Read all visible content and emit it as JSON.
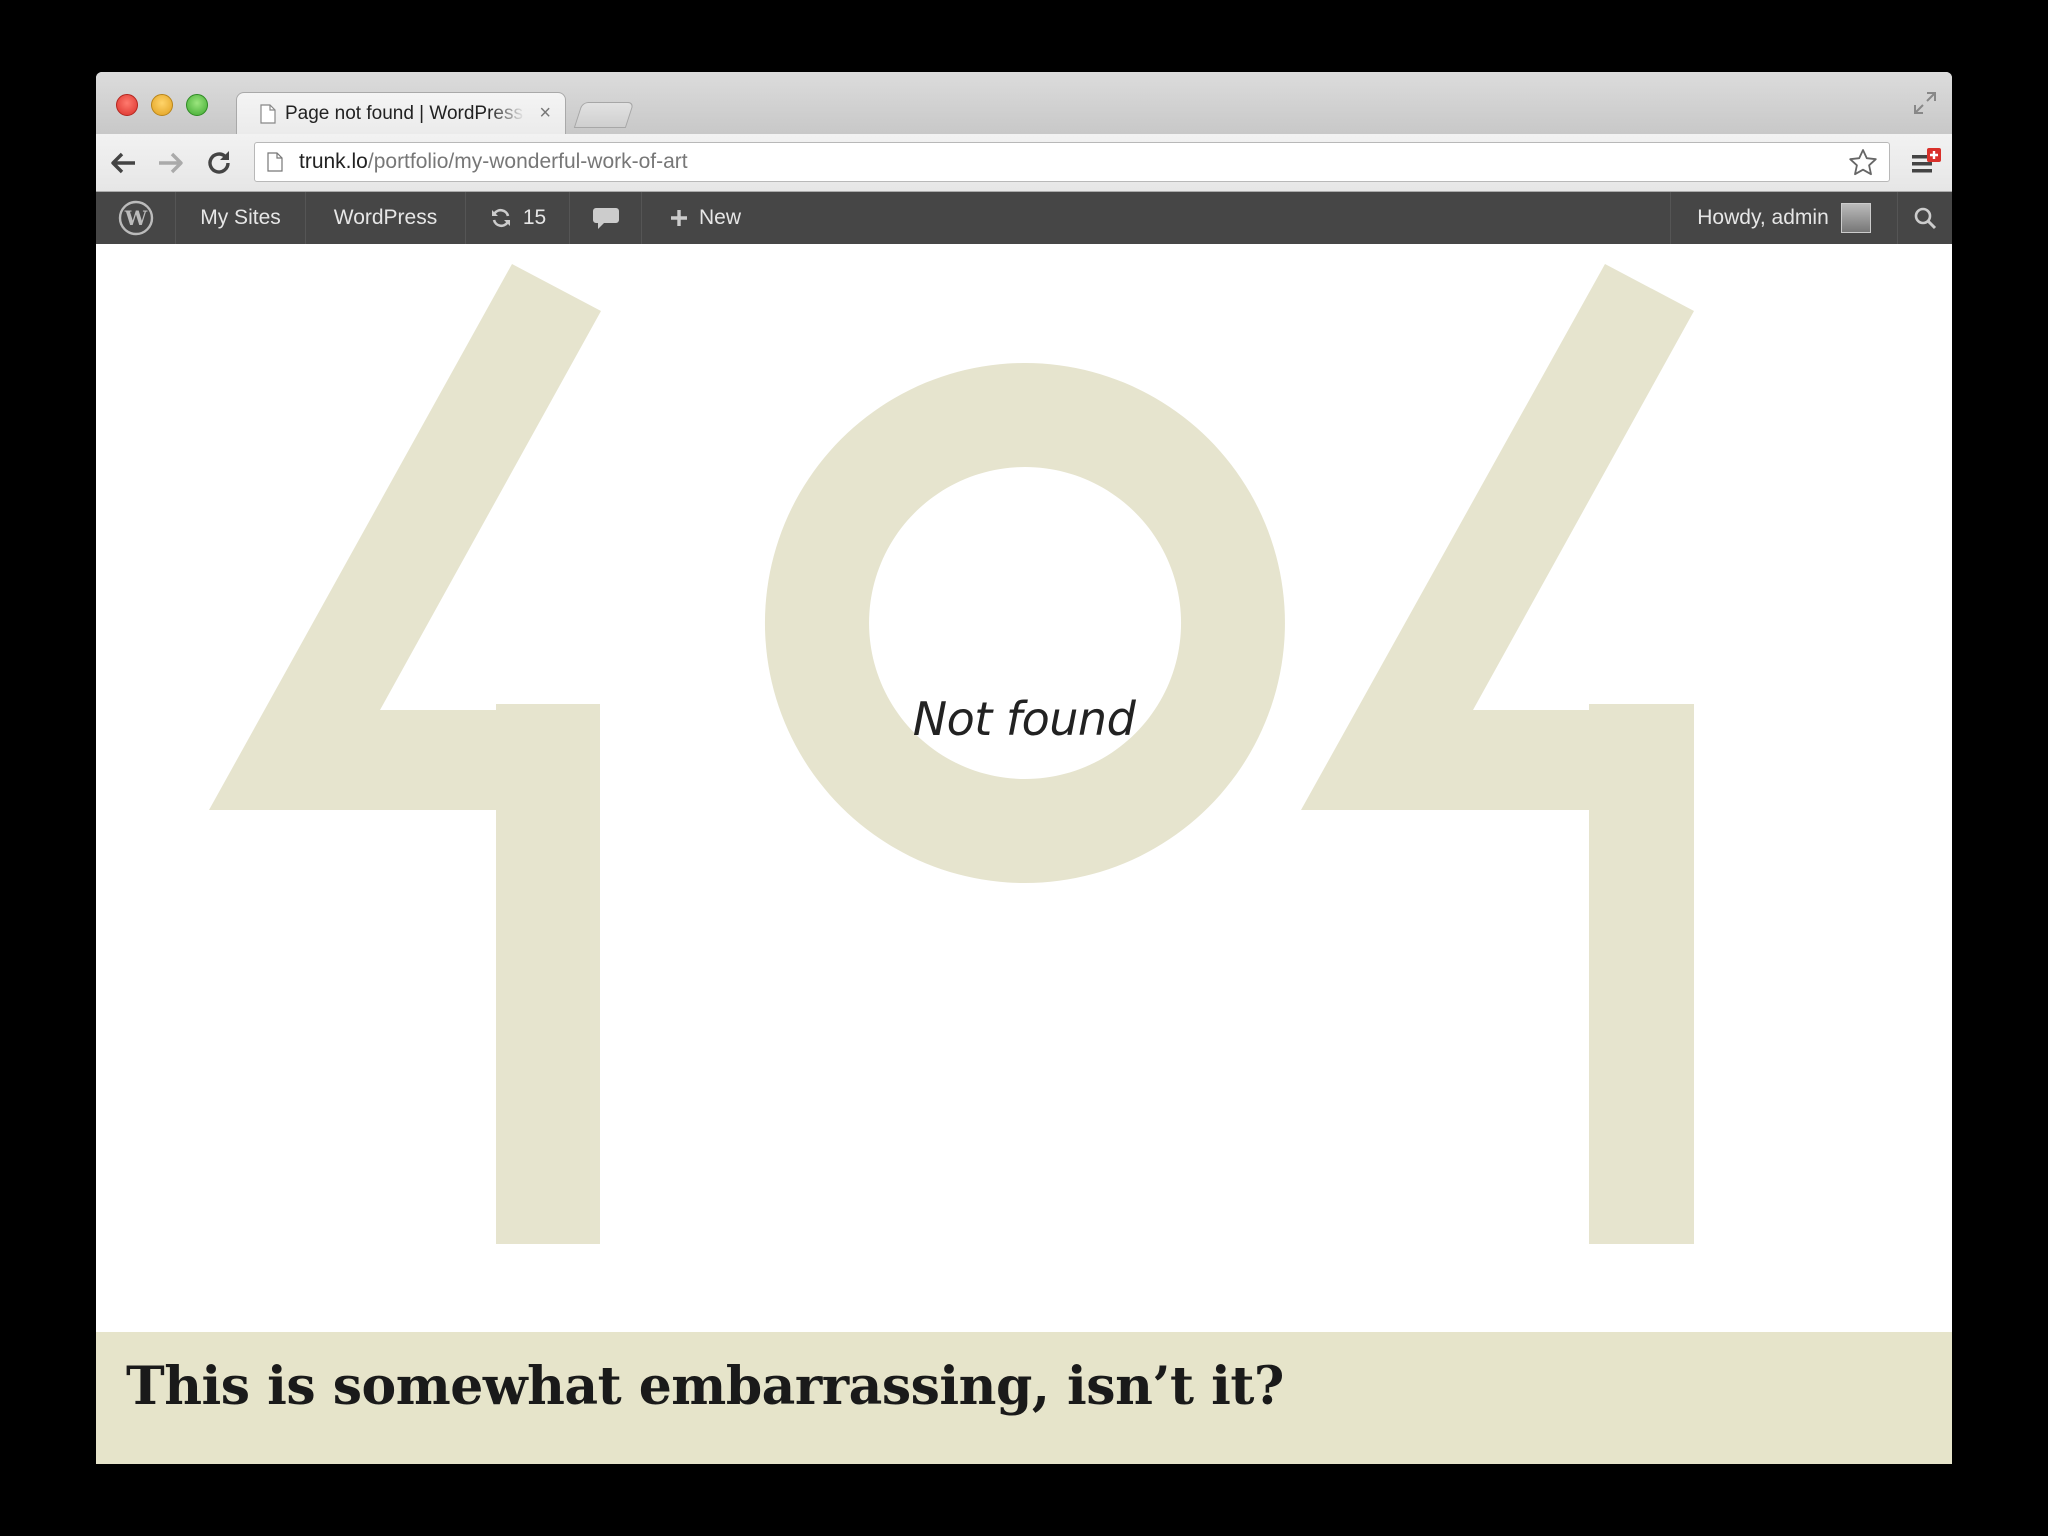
{
  "browser": {
    "tab_title": "Page not found | WordPress",
    "tab_close_glyph": "×",
    "url_domain": "trunk.lo",
    "url_path": "/portfolio/my-wonderful-work-of-art"
  },
  "adminbar": {
    "my_sites": "My Sites",
    "site_name": "WordPress",
    "updates_count": "15",
    "new_label": "New",
    "howdy": "Howdy, admin"
  },
  "page": {
    "not_found": "Not found",
    "heading": "This is somewhat embarrassing, isn’t it?"
  },
  "colors": {
    "digits": "#e6e4ce",
    "footer_band": "#e6e4ca",
    "adminbar": "#464646"
  }
}
